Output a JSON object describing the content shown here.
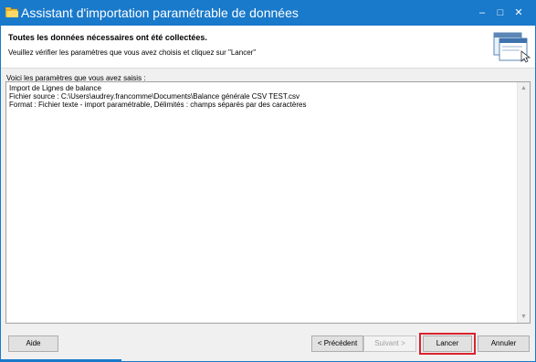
{
  "window": {
    "title": "Assistant d'importation paramétrable de données",
    "controls": {
      "minimize": "–",
      "maximize": "□",
      "close": "✕"
    }
  },
  "header": {
    "title": "Toutes les données nécessaires ont été collectées.",
    "subtitle": "Veuillez vérifier les paramètres que vous avez choisis et cliquez sur \"Lancer\""
  },
  "intro": "Voici les paramètres que vous avez saisis :",
  "params": [
    "Import de Lignes de balance",
    "Fichier source : C:\\Users\\audrey.francomme\\Documents\\Balance générale CSV TEST.csv",
    "Format : Fichier texte - import paramétrable, Délimités : champs séparés par des caractères"
  ],
  "scrollbar": {
    "up": "▲",
    "down": "▼"
  },
  "buttons": {
    "help": "Aide",
    "previous": "< Précédent",
    "next": "Suivant >",
    "launch": "Lancer",
    "cancel": "Annuler"
  },
  "colors": {
    "titlebar": "#1979ca",
    "highlight": "#d9232e"
  }
}
